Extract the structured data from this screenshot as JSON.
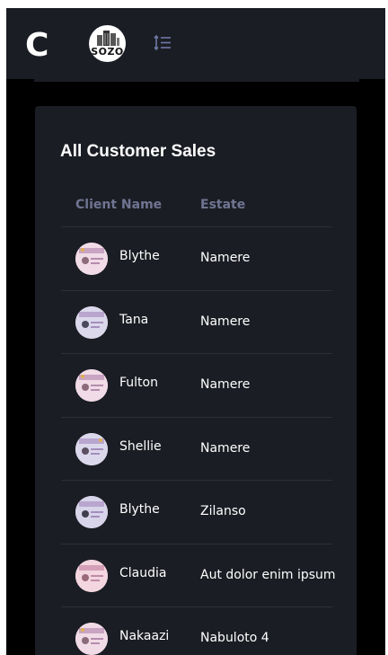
{
  "header": {
    "brand_letter": "C",
    "logo_text": "SOZO",
    "sort_icon": "sort-order-icon"
  },
  "card": {
    "title": "All Customer Sales",
    "columns": [
      "Client Name",
      "Estate"
    ],
    "rows": [
      {
        "name": "Blythe",
        "estate": "Namere"
      },
      {
        "name": "Tana",
        "estate": "Namere"
      },
      {
        "name": "Fulton",
        "estate": "Namere"
      },
      {
        "name": "Shellie",
        "estate": "Namere"
      },
      {
        "name": "Blythe",
        "estate": "Zilanso"
      },
      {
        "name": "Claudia",
        "estate": "Aut dolor enim ipsum"
      },
      {
        "name": "Nakaazi",
        "estate": "Nabuloto 4"
      }
    ]
  },
  "colors": {
    "background": "#000000",
    "surface": "#1b1d24",
    "header_text": "#6f7592",
    "accent_icon": "#6f7aa8"
  }
}
